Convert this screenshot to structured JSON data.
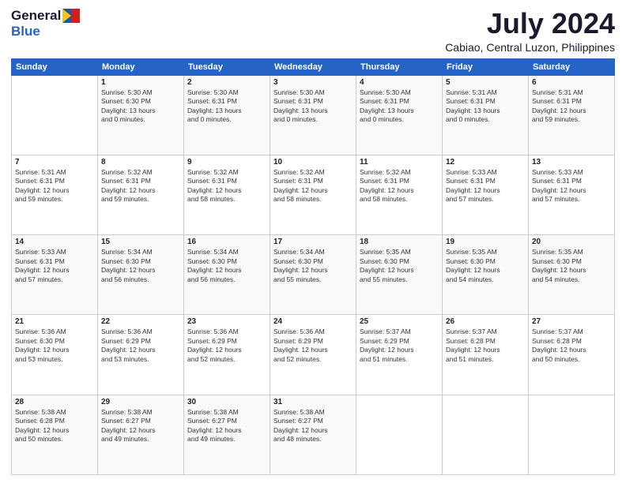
{
  "header": {
    "logo_general": "General",
    "logo_blue": "Blue",
    "month_title": "July 2024",
    "location": "Cabiao, Central Luzon, Philippines"
  },
  "weekdays": [
    "Sunday",
    "Monday",
    "Tuesday",
    "Wednesday",
    "Thursday",
    "Friday",
    "Saturday"
  ],
  "weeks": [
    [
      {
        "day": "",
        "info": ""
      },
      {
        "day": "1",
        "info": "Sunrise: 5:30 AM\nSunset: 6:30 PM\nDaylight: 13 hours\nand 0 minutes."
      },
      {
        "day": "2",
        "info": "Sunrise: 5:30 AM\nSunset: 6:31 PM\nDaylight: 13 hours\nand 0 minutes."
      },
      {
        "day": "3",
        "info": "Sunrise: 5:30 AM\nSunset: 6:31 PM\nDaylight: 13 hours\nand 0 minutes."
      },
      {
        "day": "4",
        "info": "Sunrise: 5:30 AM\nSunset: 6:31 PM\nDaylight: 13 hours\nand 0 minutes."
      },
      {
        "day": "5",
        "info": "Sunrise: 5:31 AM\nSunset: 6:31 PM\nDaylight: 13 hours\nand 0 minutes."
      },
      {
        "day": "6",
        "info": "Sunrise: 5:31 AM\nSunset: 6:31 PM\nDaylight: 12 hours\nand 59 minutes."
      }
    ],
    [
      {
        "day": "7",
        "info": "Sunrise: 5:31 AM\nSunset: 6:31 PM\nDaylight: 12 hours\nand 59 minutes."
      },
      {
        "day": "8",
        "info": "Sunrise: 5:32 AM\nSunset: 6:31 PM\nDaylight: 12 hours\nand 59 minutes."
      },
      {
        "day": "9",
        "info": "Sunrise: 5:32 AM\nSunset: 6:31 PM\nDaylight: 12 hours\nand 58 minutes."
      },
      {
        "day": "10",
        "info": "Sunrise: 5:32 AM\nSunset: 6:31 PM\nDaylight: 12 hours\nand 58 minutes."
      },
      {
        "day": "11",
        "info": "Sunrise: 5:32 AM\nSunset: 6:31 PM\nDaylight: 12 hours\nand 58 minutes."
      },
      {
        "day": "12",
        "info": "Sunrise: 5:33 AM\nSunset: 6:31 PM\nDaylight: 12 hours\nand 57 minutes."
      },
      {
        "day": "13",
        "info": "Sunrise: 5:33 AM\nSunset: 6:31 PM\nDaylight: 12 hours\nand 57 minutes."
      }
    ],
    [
      {
        "day": "14",
        "info": "Sunrise: 5:33 AM\nSunset: 6:31 PM\nDaylight: 12 hours\nand 57 minutes."
      },
      {
        "day": "15",
        "info": "Sunrise: 5:34 AM\nSunset: 6:30 PM\nDaylight: 12 hours\nand 56 minutes."
      },
      {
        "day": "16",
        "info": "Sunrise: 5:34 AM\nSunset: 6:30 PM\nDaylight: 12 hours\nand 56 minutes."
      },
      {
        "day": "17",
        "info": "Sunrise: 5:34 AM\nSunset: 6:30 PM\nDaylight: 12 hours\nand 55 minutes."
      },
      {
        "day": "18",
        "info": "Sunrise: 5:35 AM\nSunset: 6:30 PM\nDaylight: 12 hours\nand 55 minutes."
      },
      {
        "day": "19",
        "info": "Sunrise: 5:35 AM\nSunset: 6:30 PM\nDaylight: 12 hours\nand 54 minutes."
      },
      {
        "day": "20",
        "info": "Sunrise: 5:35 AM\nSunset: 6:30 PM\nDaylight: 12 hours\nand 54 minutes."
      }
    ],
    [
      {
        "day": "21",
        "info": "Sunrise: 5:36 AM\nSunset: 6:30 PM\nDaylight: 12 hours\nand 53 minutes."
      },
      {
        "day": "22",
        "info": "Sunrise: 5:36 AM\nSunset: 6:29 PM\nDaylight: 12 hours\nand 53 minutes."
      },
      {
        "day": "23",
        "info": "Sunrise: 5:36 AM\nSunset: 6:29 PM\nDaylight: 12 hours\nand 52 minutes."
      },
      {
        "day": "24",
        "info": "Sunrise: 5:36 AM\nSunset: 6:29 PM\nDaylight: 12 hours\nand 52 minutes."
      },
      {
        "day": "25",
        "info": "Sunrise: 5:37 AM\nSunset: 6:29 PM\nDaylight: 12 hours\nand 51 minutes."
      },
      {
        "day": "26",
        "info": "Sunrise: 5:37 AM\nSunset: 6:28 PM\nDaylight: 12 hours\nand 51 minutes."
      },
      {
        "day": "27",
        "info": "Sunrise: 5:37 AM\nSunset: 6:28 PM\nDaylight: 12 hours\nand 50 minutes."
      }
    ],
    [
      {
        "day": "28",
        "info": "Sunrise: 5:38 AM\nSunset: 6:28 PM\nDaylight: 12 hours\nand 50 minutes."
      },
      {
        "day": "29",
        "info": "Sunrise: 5:38 AM\nSunset: 6:27 PM\nDaylight: 12 hours\nand 49 minutes."
      },
      {
        "day": "30",
        "info": "Sunrise: 5:38 AM\nSunset: 6:27 PM\nDaylight: 12 hours\nand 49 minutes."
      },
      {
        "day": "31",
        "info": "Sunrise: 5:38 AM\nSunset: 6:27 PM\nDaylight: 12 hours\nand 48 minutes."
      },
      {
        "day": "",
        "info": ""
      },
      {
        "day": "",
        "info": ""
      },
      {
        "day": "",
        "info": ""
      }
    ]
  ]
}
